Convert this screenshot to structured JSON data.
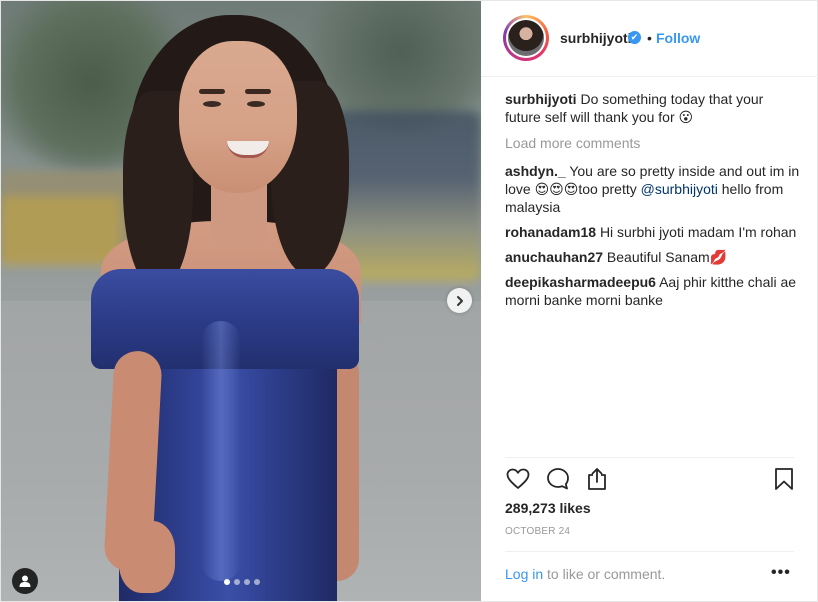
{
  "post": {
    "username": "surbhijyoti",
    "separator": "•",
    "follow_label": "Follow",
    "verified_mark": "✔",
    "caption_user": "surbhijyoti",
    "caption_text": "Do something today that your future self will thank you for 😮",
    "load_more": "Load more comments",
    "comments": [
      {
        "user": "ashdyn._",
        "text_a": "You are so pretty inside and out im in love 😍😍😍too pretty",
        "mention": "@surbhijyoti",
        "text_b": "hello from malaysia"
      },
      {
        "user": "rohanadam18",
        "text": "Hi surbhi jyoti madam I'm rohan"
      },
      {
        "user": "anuchauhan27",
        "text": "Beautiful Sanam💋"
      },
      {
        "user": "deepikasharmadeepu6",
        "text": "Aaj phir kitthe chali ae morni banke morni banke"
      }
    ],
    "likes": "289,273 likes",
    "date": "OCTOBER 24",
    "login_link": "Log in",
    "login_rest": "to like or comment.",
    "more_label": "•••"
  },
  "icons": {
    "like": "heart-icon",
    "comment": "comment-bubble-icon",
    "share": "share-icon",
    "save": "bookmark-icon",
    "next": "chevron-right-icon",
    "tag": "person-tag-icon"
  },
  "carousel": {
    "count": 4,
    "active": 0
  },
  "colors": {
    "link": "#3897f0",
    "mention": "#003569",
    "muted": "#999999",
    "text": "#262626"
  }
}
